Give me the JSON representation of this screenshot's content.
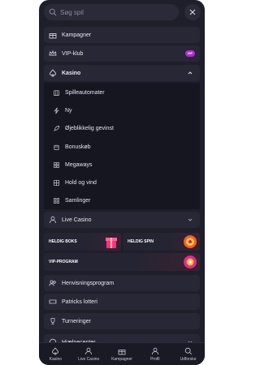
{
  "search": {
    "placeholder": "Søg spil"
  },
  "menu": {
    "kampagner": "Kampagner",
    "vip_klub": "VIP-klub",
    "vip_badge": "VIP",
    "kasino": "Kasino",
    "live_casino": "Live Casino",
    "henvisningsprogram": "Henvisningsprogram",
    "patricks_lotteri": "Patricks lotteri",
    "turneringer": "Turneringer",
    "hjaelpecenter": "Hjælpecenter"
  },
  "kasino_submenu": [
    {
      "label": "Spilleautomater",
      "icon": "slot-machine-icon"
    },
    {
      "label": "Ny",
      "icon": "lightning-icon"
    },
    {
      "label": "Øjeblikkelig gevinst",
      "icon": "rocket-icon"
    },
    {
      "label": "Bonuskøb",
      "icon": "bonus-icon"
    },
    {
      "label": "Megaways",
      "icon": "megaways-icon"
    },
    {
      "label": "Hold og vind",
      "icon": "hold-win-icon"
    },
    {
      "label": "Samlinger",
      "icon": "collections-icon"
    }
  ],
  "promos": {
    "heldig_boks": "HELDIG BOKS",
    "heldig_spin": "HELDIG SPIN",
    "vip_program": "VIP-PROGRAM"
  },
  "bottom_nav": {
    "kasino": "Kasino",
    "live_casino": "Live Casino",
    "kampagner": "Kampagner",
    "profil": "Profil",
    "udforske": "Udforske"
  },
  "colors": {
    "vip_badge": "#b42bd0",
    "background": "#1f1f2c"
  }
}
